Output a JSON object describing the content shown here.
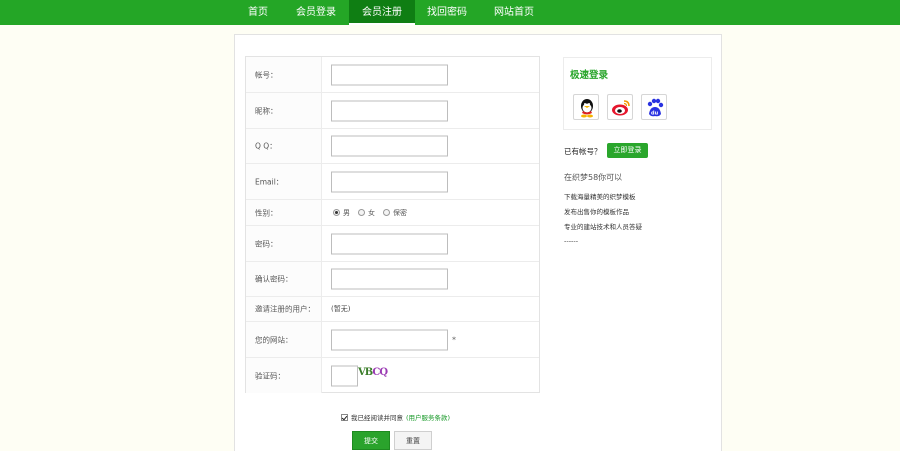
{
  "nav": {
    "items": [
      "首页",
      "会员登录",
      "会员注册",
      "找回密码",
      "网站首页"
    ],
    "active_index": 2
  },
  "form": {
    "account_label": "帐号：",
    "nickname_label": "昵称：",
    "qq_label": "Q Q：",
    "email_label": "Email：",
    "gender_label": "性别：",
    "gender_options": [
      "男",
      "女",
      "保密"
    ],
    "gender_selected": "男",
    "password_label": "密码：",
    "confirm_label": "确认密码：",
    "recommender_label": "邀请注册的用户：",
    "recommender_value": "(暂无)",
    "homepage_label": "您的网站：",
    "homepage_required_mark": "*",
    "captcha_label": "验证码：",
    "captcha_text_1": "VB",
    "captcha_text_2": "CQ"
  },
  "agree": {
    "text": "我已经阅读并同意",
    "link": "(用户服务条款)"
  },
  "buttons": {
    "submit": "提交",
    "reset": "重置"
  },
  "sidebar": {
    "quick_login_title": "极速登录",
    "social_icons": [
      "qq-icon",
      "weibo-icon",
      "baidu-icon"
    ],
    "has_account_text": "已有帐号？",
    "login_button": "立即登录",
    "can_title": "在织梦58你可以",
    "bullets": [
      "下载海量精美的织梦模板",
      "发布出售你的模板作品",
      "专业的建站技术和人员答疑",
      "------"
    ]
  },
  "colors": {
    "nav_bg": "#24a626",
    "nav_active": "#0f7e13",
    "accent": "#2aa62c",
    "page_bg": "#fefef4"
  }
}
